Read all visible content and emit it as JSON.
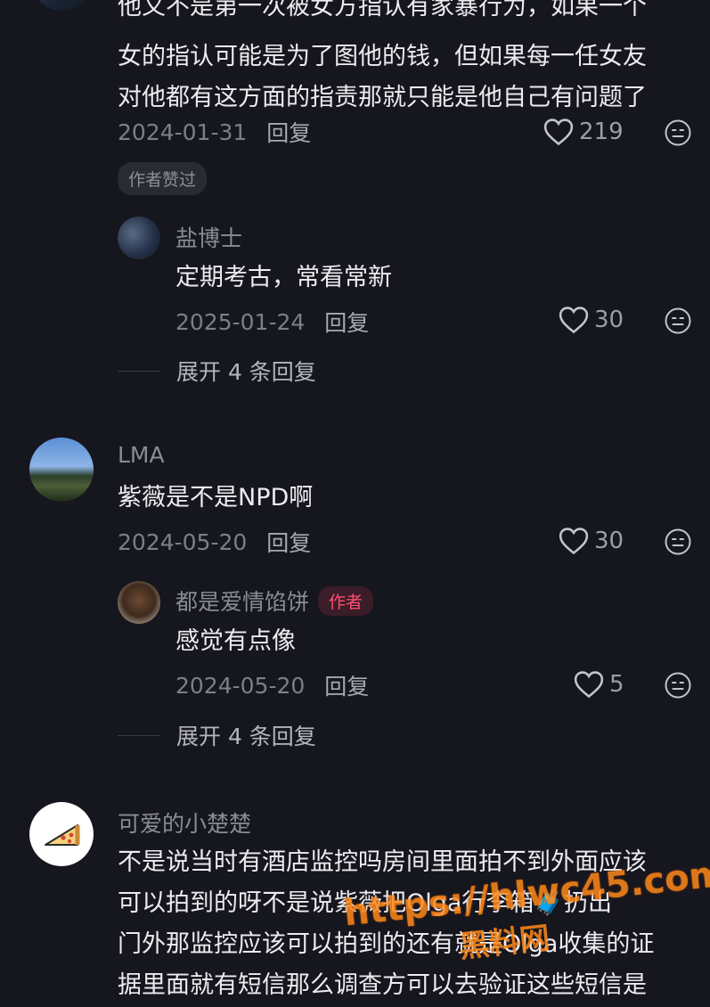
{
  "comment1": {
    "lines": [
      "他又不是第一次被女方指认有家暴行为，如果一个",
      "女的指认可能是为了图他的钱，但如果每一任女友",
      "对他都有这方面的指责那就只能是他自己有问题了"
    ],
    "date": "2024-01-31",
    "reply_label": "回复",
    "likes": "219",
    "tag": "作者赞过",
    "reply": {
      "name": "盐博士",
      "text": "定期考古，常看常新",
      "date": "2025-01-24",
      "reply_label": "回复",
      "likes": "30"
    },
    "expand": "展开 4 条回复"
  },
  "comment2": {
    "name": "LMA",
    "text": "紫薇是不是NPD啊",
    "date": "2024-05-20",
    "reply_label": "回复",
    "likes": "30",
    "reply": {
      "name": "都是爱情馅饼",
      "author_tag": "作者",
      "text": "感觉有点像",
      "date": "2024-05-20",
      "reply_label": "回复",
      "likes": "5"
    },
    "expand": "展开 4 条回复"
  },
  "comment3": {
    "name": "可爱的小楚楚",
    "lines": [
      "不是说当时有酒店监控吗房间里面拍不到外面应该",
      "可以拍到的呀不是说紫薇把Olga行李箱🧳扔出",
      "门外那监控应该可以拍到的还有就是Olga收集的证",
      "据里面就有短信那么调查方可以去验证这些短信是"
    ]
  },
  "watermark": {
    "url": "https://hlwc45.com",
    "site": "黑料网"
  },
  "icons": {
    "like": "heart-outline-icon",
    "dislike": "meh-face-icon",
    "pizza": "pizza-slice-icon"
  }
}
